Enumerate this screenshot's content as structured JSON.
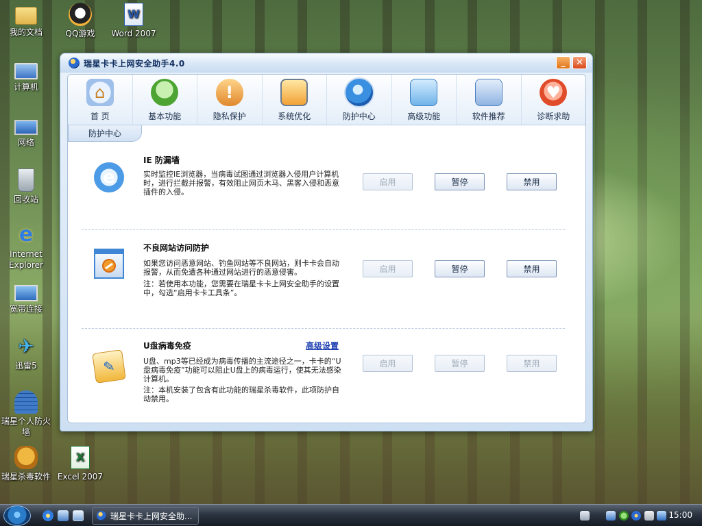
{
  "desktop": {
    "icons": [
      {
        "label": "我的文档",
        "icon": "folder-icon"
      },
      {
        "label": "QQ游戏",
        "icon": "qq-icon"
      },
      {
        "label": "Word 2007",
        "icon": "word-icon"
      },
      {
        "label": "计算机",
        "icon": "computer-icon"
      },
      {
        "label": "网络",
        "icon": "network-icon"
      },
      {
        "label": "回收站",
        "icon": "recycle-bin-icon"
      },
      {
        "label": "Internet Explorer",
        "icon": "ie-icon"
      },
      {
        "label": "宽带连接",
        "icon": "broadband-icon"
      },
      {
        "label": "迅雷5",
        "icon": "thunder-icon"
      },
      {
        "label": "瑞星个人防火墙",
        "icon": "firewall-icon"
      },
      {
        "label": "瑞星杀毒软件",
        "icon": "antivirus-icon"
      },
      {
        "label": "Excel 2007",
        "icon": "excel-icon"
      }
    ]
  },
  "window": {
    "title": "瑞星卡卡上网安全助手4.0",
    "minimize_glyph": "_",
    "close_glyph": "✕",
    "toolbar": [
      {
        "label": "首 页",
        "icon": "home-icon"
      },
      {
        "label": "基本功能",
        "icon": "mouse-icon"
      },
      {
        "label": "隐私保护",
        "icon": "shield-icon"
      },
      {
        "label": "系统优化",
        "icon": "monitor-gear-icon"
      },
      {
        "label": "防护中心",
        "icon": "protection-globe-icon",
        "active": true
      },
      {
        "label": "高级功能",
        "icon": "cubes-icon"
      },
      {
        "label": "软件推荐",
        "icon": "windows-icon"
      },
      {
        "label": "诊断求助",
        "icon": "heart-hand-icon"
      }
    ],
    "subtab": "防护中心",
    "sections": [
      {
        "title": "IE 防漏墙",
        "desc": "实时监控IE浏览器，当病毒试图通过浏览器入侵用户计算机时，进行拦截并报警，有效阻止网页木马、黑客入侵和恶意插件的入侵。",
        "note": "",
        "link": "",
        "buttons": [
          {
            "label": "启用",
            "enabled": false
          },
          {
            "label": "暂停",
            "enabled": true
          },
          {
            "label": "禁用",
            "enabled": true
          }
        ]
      },
      {
        "title": "不良网站访问防护",
        "desc": "如果您访问恶意网站、钓鱼网站等不良网站，则卡卡会自动报警，从而免遭各种通过网站进行的恶意侵害。",
        "note": "注：若使用本功能，您需要在瑞星卡卡上网安全助手的设置中，勾选“启用卡卡工具条”。",
        "link": "",
        "buttons": [
          {
            "label": "启用",
            "enabled": false
          },
          {
            "label": "暂停",
            "enabled": true
          },
          {
            "label": "禁用",
            "enabled": true
          }
        ]
      },
      {
        "title": "U盘病毒免疫",
        "desc": "U盘、mp3等已经成为病毒传播的主流途径之一，卡卡的“U盘病毒免疫”功能可以阻止U盘上的病毒运行，使其无法感染计算机。",
        "note": "注：本机安装了包含有此功能的瑞星杀毒软件，此项防护自动禁用。",
        "link": "高级设置",
        "buttons": [
          {
            "label": "启用",
            "enabled": false
          },
          {
            "label": "暂停",
            "enabled": false
          },
          {
            "label": "禁用",
            "enabled": false
          }
        ]
      }
    ]
  },
  "taskbar": {
    "task_label": "瑞星卡卡上网安全助...",
    "clock": "15:00"
  }
}
